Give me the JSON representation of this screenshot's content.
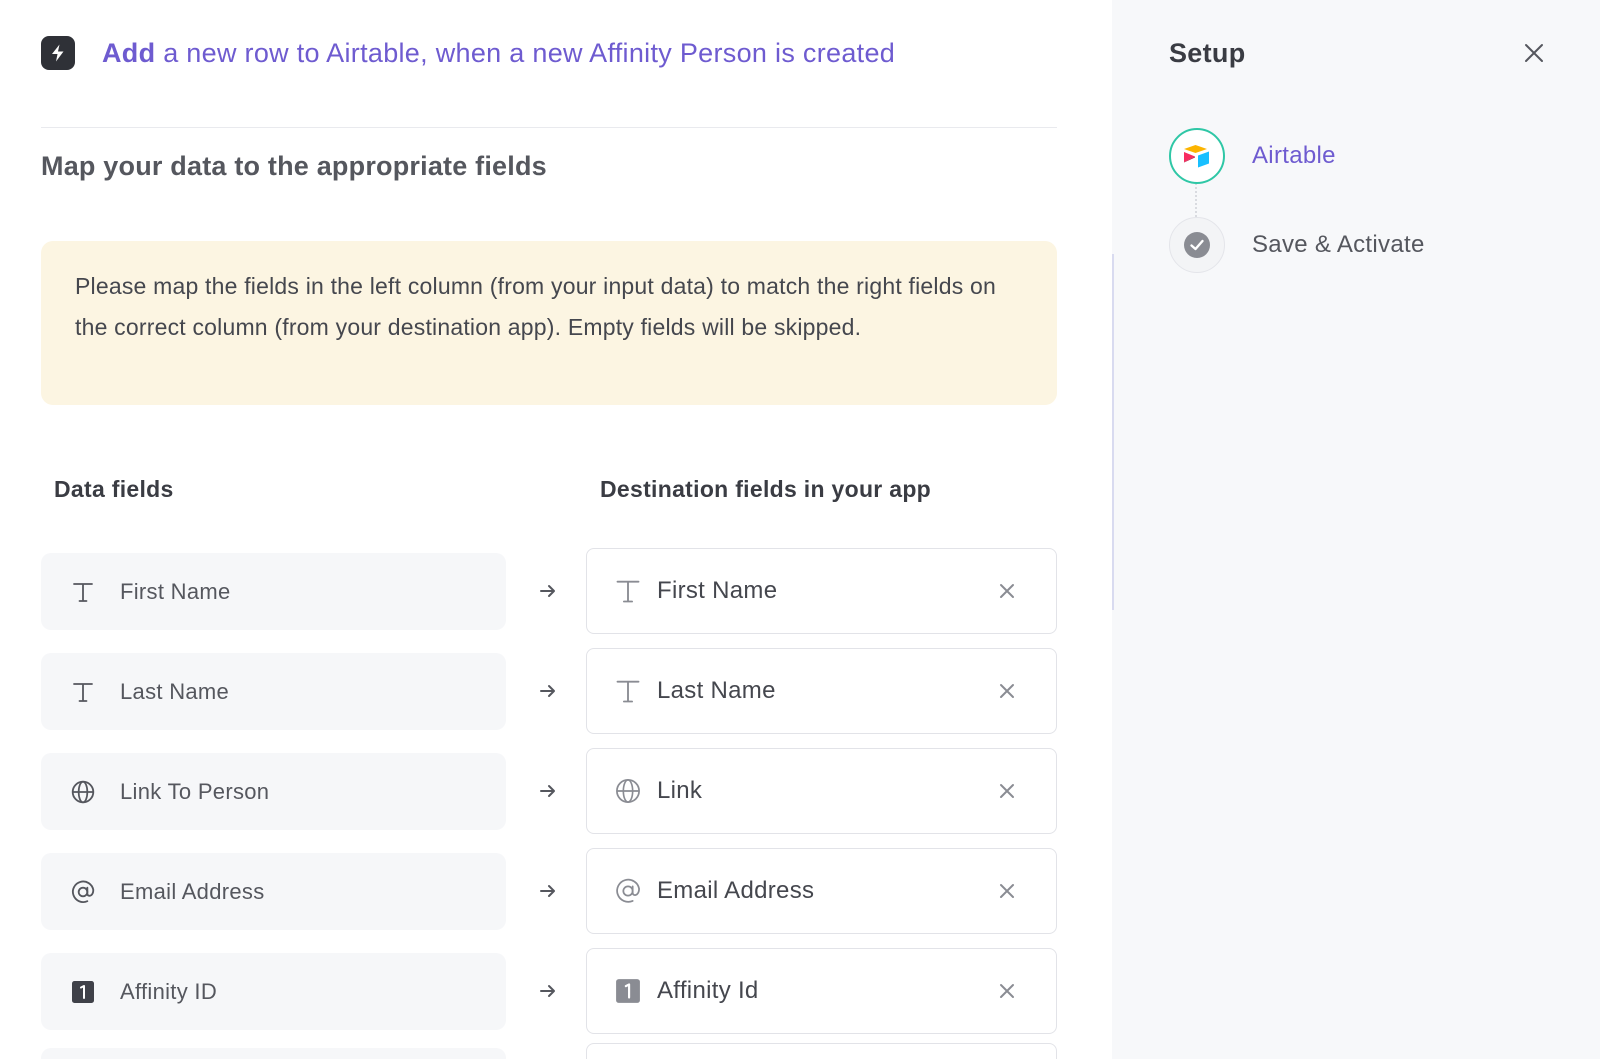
{
  "header": {
    "icon": "lightning-bolt-icon",
    "action": "Add",
    "rest": " a new row to Airtable, when a new Affinity Person is created"
  },
  "subtitle": "Map your data to the appropriate fields",
  "notice": "Please map the fields in the left column (from your input data) to match the right fields on the correct column (from your destination app). Empty fields will be skipped.",
  "columns": {
    "data": "Data fields",
    "destination": "Destination fields in your app"
  },
  "mappings": [
    {
      "source": "First Name",
      "source_icon": "text-type-icon",
      "destination": "First Name",
      "destination_icon": "text-type-icon"
    },
    {
      "source": "Last Name",
      "source_icon": "text-type-icon",
      "destination": "Last Name",
      "destination_icon": "text-type-icon"
    },
    {
      "source": "Link To Person",
      "source_icon": "globe-icon",
      "destination": "Link",
      "destination_icon": "globe-icon"
    },
    {
      "source": "Email Address",
      "source_icon": "at-sign-icon",
      "destination": "Email Address",
      "destination_icon": "at-sign-icon"
    },
    {
      "source": "Affinity ID",
      "source_icon": "number-type-icon",
      "destination": "Affinity Id",
      "destination_icon": "number-type-icon"
    }
  ],
  "sidebar": {
    "title": "Setup",
    "steps": [
      {
        "label": "Airtable",
        "icon": "airtable-logo-icon",
        "state": "active"
      },
      {
        "label": "Save & Activate",
        "icon": "check-circle-icon",
        "state": "pending"
      }
    ]
  },
  "colors": {
    "accent": "#6e5bd0",
    "notice_bg": "#fcf5e2",
    "active_step_ring": "#2fc7a6"
  }
}
